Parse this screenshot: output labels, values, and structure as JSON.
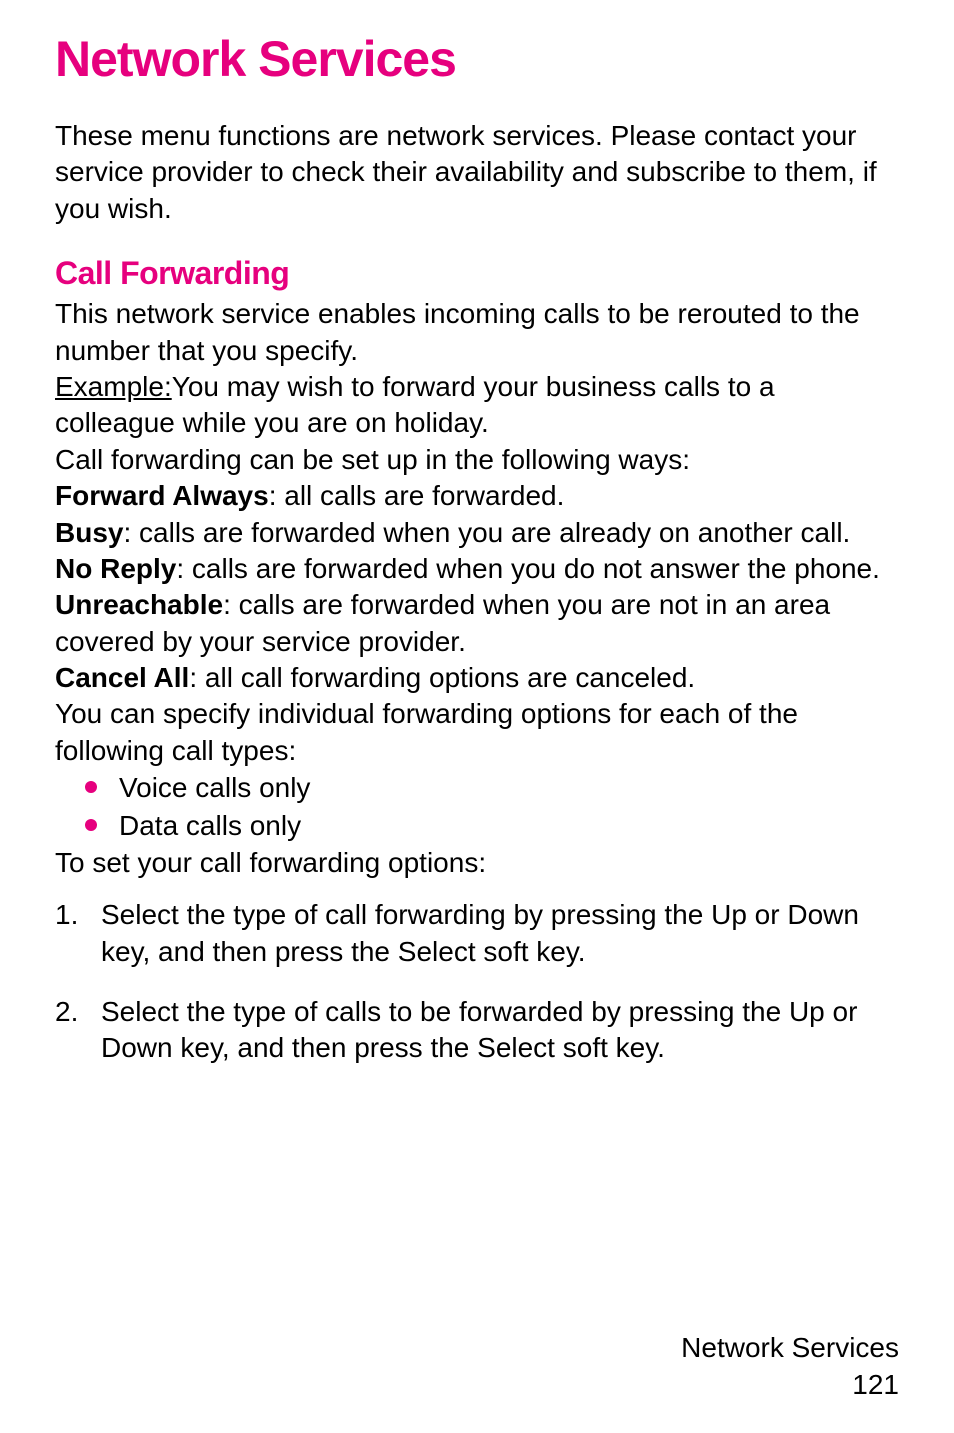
{
  "title": "Network Services",
  "intro": "These menu functions are network services. Please contact your service provider to check their availability and subscribe to them, if you wish.",
  "section": {
    "heading": "Call Forwarding",
    "p1": "This network service enables incoming calls to be rerouted to the number that you specify.",
    "example_label": "Example:",
    "example_text": "You may wish to forward your business calls to a colleague while you are on holiday.",
    "p2": "Call forwarding can be set up in the following ways:",
    "options": {
      "forward_always": {
        "label": "Forward Always",
        "text": ": all calls are forwarded."
      },
      "busy": {
        "label": "Busy",
        "text": ": calls are forwarded when you are already on another call."
      },
      "no_reply": {
        "label": "No Reply",
        "text": ": calls are forwarded when you do not answer the phone."
      },
      "unreachable": {
        "label": "Unreachable",
        "text": ": calls are forwarded when you are not in an area covered by your service provider."
      },
      "cancel_all": {
        "label": "Cancel All",
        "text": ": all call forwarding options are canceled."
      }
    },
    "p3": "You can specify individual forwarding options for each of the following call types:",
    "bullets": {
      "b1": "Voice calls only",
      "b2": "Data calls only"
    },
    "p4": "To set your call forwarding options:",
    "steps": {
      "s1_num": "1.",
      "s1_pre": "Select the type of call forwarding by pressing the Up or Down key, and then press the ",
      "s1_bold": "Select",
      "s1_post": " soft key.",
      "s2_num": "2.",
      "s2_pre": "Select the type of calls to be forwarded by pressing the Up or Down key, and then press the ",
      "s2_bold": "Select",
      "s2_post": " soft key."
    }
  },
  "footer": {
    "label": "Network Services",
    "page": "121"
  }
}
